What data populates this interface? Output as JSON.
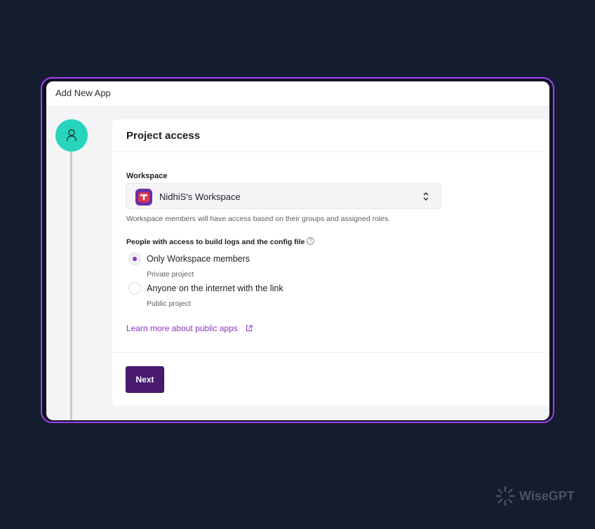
{
  "window": {
    "title": "Add New App"
  },
  "step": {
    "icon": "user-icon"
  },
  "card": {
    "title": "Project access",
    "workspace_label": "Workspace",
    "workspace_value": "NidhiS's Workspace",
    "workspace_helper": "Workspace members will have access based on their groups and assigned roles.",
    "access_label": "People with access to build logs and the config file",
    "options": [
      {
        "title": "Only Workspace members",
        "description": "Private project",
        "selected": true
      },
      {
        "title": "Anyone on the internet with the link",
        "description": "Public project",
        "selected": false
      }
    ],
    "learn_more": "Learn more about public apps",
    "next_label": "Next"
  },
  "watermark": {
    "text": "WiseGPT"
  },
  "colors": {
    "background": "#141c30",
    "frame_border": "#a63ff0",
    "step_teal": "#27d5bc",
    "accent_purple": "#8a35c4",
    "button_purple": "#4a1a6e"
  }
}
